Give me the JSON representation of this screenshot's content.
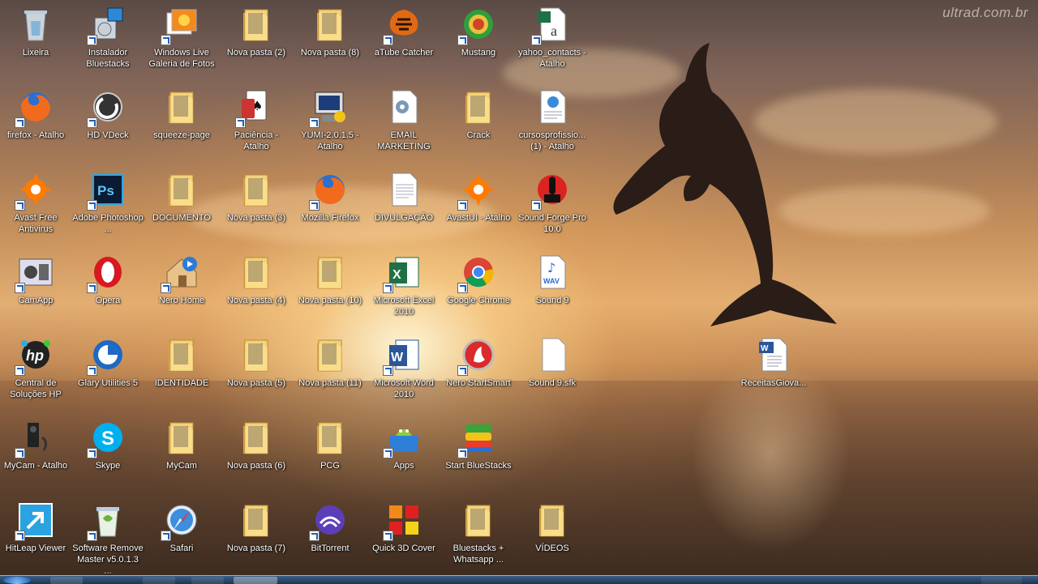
{
  "watermark": "ultrad.com.br",
  "icons": [
    {
      "label": "Lixeira",
      "icon": "recycle-bin-icon"
    },
    {
      "label": "Instalador Bluestacks",
      "icon": "installer-icon"
    },
    {
      "label": "Windows Live Galeria de Fotos",
      "icon": "photo-gallery-icon"
    },
    {
      "label": "Nova pasta (2)",
      "icon": "folder-icon"
    },
    {
      "label": "Nova pasta (8)",
      "icon": "folder-icon"
    },
    {
      "label": "aTube Catcher",
      "icon": "atube-icon"
    },
    {
      "label": "Mustang",
      "icon": "mustang-icon"
    },
    {
      "label": "yahoo_contacts - Atalho",
      "icon": "csv-file-icon"
    },
    {
      "label": "firefox - Atalho",
      "icon": "firefox-icon"
    },
    {
      "label": "HD VDeck",
      "icon": "hdvdeck-icon"
    },
    {
      "label": "squeeze-page",
      "icon": "folder-icon"
    },
    {
      "label": "Paciência - Atalho",
      "icon": "solitaire-icon"
    },
    {
      "label": "YUMI-2.0.1.5 - Atalho",
      "icon": "yumi-icon"
    },
    {
      "label": "EMAIL MARKETING",
      "icon": "settings-file-icon"
    },
    {
      "label": "Crack",
      "icon": "folder-icon"
    },
    {
      "label": "cursosprofissio... (1) - Atalho",
      "icon": "html-file-icon"
    },
    {
      "label": "Avast Free Antivirus",
      "icon": "avast-icon"
    },
    {
      "label": "Adobe Photoshop ...",
      "icon": "photoshop-icon"
    },
    {
      "label": "DOCUMENTO",
      "icon": "folder-icon"
    },
    {
      "label": "Nova pasta (3)",
      "icon": "folder-icon"
    },
    {
      "label": "Mozilla Firefox",
      "icon": "firefox-icon"
    },
    {
      "label": "DIVULGAÇÃO",
      "icon": "text-file-icon"
    },
    {
      "label": "AvastUI - Atalho",
      "icon": "avast-icon"
    },
    {
      "label": "Sound Forge Pro 10.0",
      "icon": "soundforge-icon"
    },
    {
      "label": "CamApp",
      "icon": "camapp-icon"
    },
    {
      "label": "Opera",
      "icon": "opera-icon"
    },
    {
      "label": "Nero Home",
      "icon": "nero-home-icon"
    },
    {
      "label": "Nova pasta (4)",
      "icon": "folder-icon"
    },
    {
      "label": "Nova pasta (10)",
      "icon": "folder-icon"
    },
    {
      "label": "Microsoft Excel 2010",
      "icon": "excel-icon"
    },
    {
      "label": "Google Chrome",
      "icon": "chrome-icon"
    },
    {
      "label": "Sound 9",
      "icon": "wav-file-icon"
    },
    {
      "label": "Central de Soluções HP",
      "icon": "hp-icon"
    },
    {
      "label": "Glary Utilities 5",
      "icon": "glary-icon"
    },
    {
      "label": "IDENTIDADE",
      "icon": "folder-icon"
    },
    {
      "label": "Nova pasta (5)",
      "icon": "folder-icon"
    },
    {
      "label": "Nova pasta (11)",
      "icon": "folder-icon"
    },
    {
      "label": "Microsoft Word 2010",
      "icon": "word-icon"
    },
    {
      "label": "Nero StartSmart",
      "icon": "nero-icon"
    },
    {
      "label": "Sound 9.sfk",
      "icon": "blank-file-icon"
    },
    {
      "label": "ReceitasGiova...",
      "icon": "word-doc-icon"
    },
    {
      "label": "MyCam - Atalho",
      "icon": "mycam-icon"
    },
    {
      "label": "Skype",
      "icon": "skype-icon"
    },
    {
      "label": "MyCam",
      "icon": "folder-icon"
    },
    {
      "label": "Nova pasta (6)",
      "icon": "folder-icon"
    },
    {
      "label": "PCG",
      "icon": "folder-icon"
    },
    {
      "label": "Apps",
      "icon": "apps-icon"
    },
    {
      "label": "Start BlueStacks",
      "icon": "bluestacks-icon"
    },
    {
      "label": "HitLeap Viewer",
      "icon": "hitleap-icon"
    },
    {
      "label": "Software Remove Master v5.0.1.3 ...",
      "icon": "remove-master-icon"
    },
    {
      "label": "Safari",
      "icon": "safari-icon"
    },
    {
      "label": "Nova pasta (7)",
      "icon": "folder-icon"
    },
    {
      "label": "BitTorrent",
      "icon": "bittorrent-icon"
    },
    {
      "label": "Quick 3D Cover",
      "icon": "quick3d-icon"
    },
    {
      "label": "Bluestacks + Whatsapp ...",
      "icon": "folder-icon"
    },
    {
      "label": "VÍDEOS",
      "icon": "folder-icon"
    }
  ]
}
